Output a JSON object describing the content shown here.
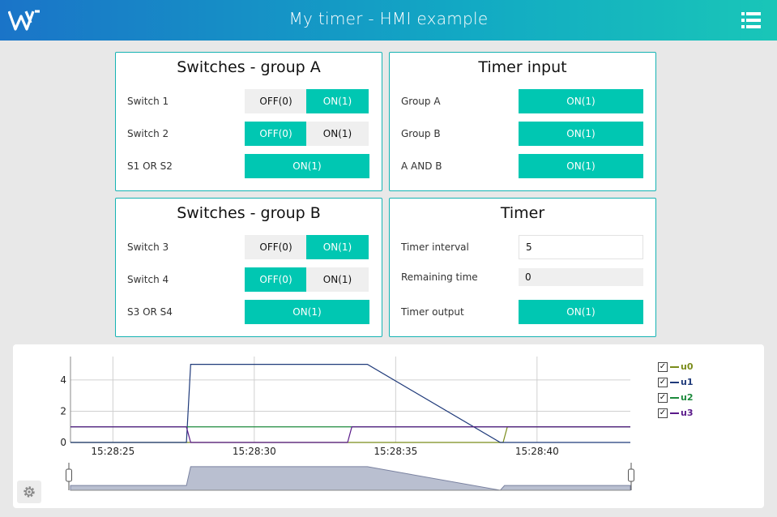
{
  "app": {
    "title": "My timer - HMI example",
    "logo_icon": "w-logo-icon",
    "menu_icon": "list-menu-icon"
  },
  "cards": {
    "group_a": {
      "title": "Switches - group A",
      "switch1": {
        "label": "Switch 1",
        "off": "OFF(0)",
        "on": "ON(1)",
        "value": 1
      },
      "switch2": {
        "label": "Switch 2",
        "off": "OFF(0)",
        "on": "ON(1)",
        "value": 0
      },
      "or": {
        "label": "S1 OR S2",
        "value": "ON(1)"
      }
    },
    "timer_input": {
      "title": "Timer input",
      "group_a": {
        "label": "Group A",
        "value": "ON(1)"
      },
      "group_b": {
        "label": "Group B",
        "value": "ON(1)"
      },
      "and": {
        "label": "A AND B",
        "value": "ON(1)"
      }
    },
    "group_b": {
      "title": "Switches - group B",
      "switch3": {
        "label": "Switch 3",
        "off": "OFF(0)",
        "on": "ON(1)",
        "value": 1
      },
      "switch4": {
        "label": "Switch 4",
        "off": "OFF(0)",
        "on": "ON(1)",
        "value": 0
      },
      "or": {
        "label": "S3 OR S4",
        "value": "ON(1)"
      }
    },
    "timer": {
      "title": "Timer",
      "interval": {
        "label": "Timer interval",
        "value": "5"
      },
      "remaining": {
        "label": "Remaining time",
        "value": "0"
      },
      "output": {
        "label": "Timer output",
        "value": "ON(1)"
      }
    }
  },
  "colors": {
    "accent": "#00c7b2",
    "u0": "#7a8c1a",
    "u1": "#1f3a7a",
    "u2": "#1c8a3c",
    "u3": "#5a1a8a"
  },
  "chart_data": {
    "type": "line",
    "x_ticks": [
      "15:28:25",
      "15:28:30",
      "15:28:35",
      "15:28:40"
    ],
    "y_ticks": [
      "0",
      "2",
      "4"
    ],
    "xlim": [
      23.5,
      43.3
    ],
    "ylim": [
      0,
      5.5
    ],
    "grid": true,
    "legend_position": "right",
    "series": [
      {
        "name": "u0",
        "checked": true,
        "color": "#7a8c1a",
        "x": [
          23.5,
          38.8,
          38.95,
          43.3
        ],
        "y": [
          0,
          0,
          1,
          1
        ]
      },
      {
        "name": "u1",
        "checked": true,
        "color": "#1f3a7a",
        "x": [
          23.5,
          27.6,
          27.75,
          34.0,
          38.7,
          38.85,
          43.3
        ],
        "y": [
          0,
          0,
          5,
          5,
          0,
          0,
          0
        ]
      },
      {
        "name": "u2",
        "checked": true,
        "color": "#1c8a3c",
        "x": [
          23.5,
          27.6,
          27.75,
          43.3
        ],
        "y": [
          1,
          1,
          1,
          1
        ]
      },
      {
        "name": "u3",
        "checked": true,
        "color": "#5a1a8a",
        "x": [
          23.5,
          27.6,
          27.75,
          33.3,
          33.45,
          43.3
        ],
        "y": [
          1,
          1,
          0,
          0,
          1,
          1
        ]
      }
    ],
    "navigator": {
      "x": [
        23.5,
        27.6,
        27.75,
        34.0,
        38.7,
        38.85,
        43.3
      ],
      "y": [
        1,
        1,
        5,
        5,
        0,
        1,
        1
      ]
    }
  },
  "settings_icon": "gear-icon"
}
